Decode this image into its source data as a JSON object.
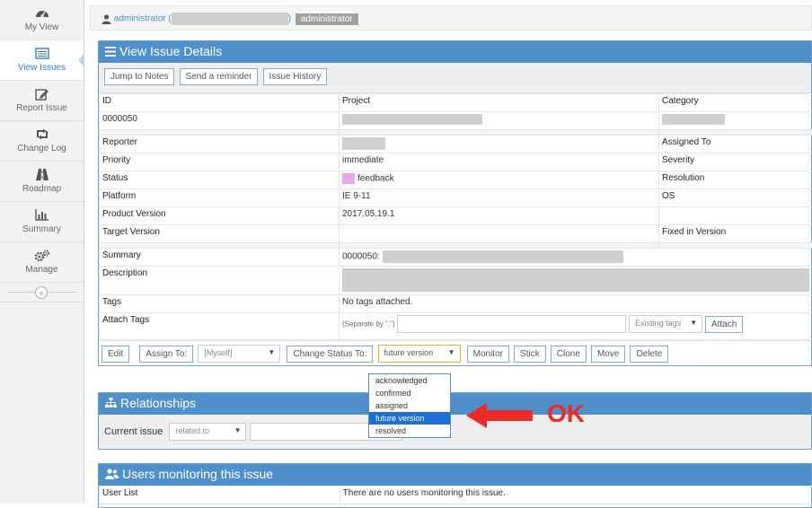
{
  "sidebar": {
    "items": [
      {
        "label": "My View",
        "icon": "dashboard-icon"
      },
      {
        "label": "View Issues",
        "icon": "list-icon",
        "active": true
      },
      {
        "label": "Report Issue",
        "icon": "edit-icon"
      },
      {
        "label": "Change Log",
        "icon": "retweet-icon"
      },
      {
        "label": "Roadmap",
        "icon": "road-icon"
      },
      {
        "label": "Summary",
        "icon": "bar-chart-icon"
      },
      {
        "label": "Manage",
        "icon": "gears-icon"
      }
    ],
    "collapse_glyph": "«"
  },
  "breadcrumb": {
    "user": "administrator (",
    "user_suffix": ")",
    "role": "administrator"
  },
  "issue": {
    "title": "View Issue Details",
    "toolbar": [
      "Jump to Notes",
      "Send a reminder",
      "Issue History"
    ],
    "headers": {
      "id": "ID",
      "project": "Project",
      "category": "Category"
    },
    "id": "0000050",
    "fields": {
      "reporter": "Reporter",
      "assigned_to": "Assigned To",
      "priority": "Priority",
      "priority_value": "immediate",
      "severity": "Severity",
      "status": "Status",
      "status_value": "feedback",
      "status_color": "#e8a8ea",
      "resolution": "Resolution",
      "platform": "Platform",
      "platform_value": "IE 9-11",
      "os": "OS",
      "product_version": "Product Version",
      "product_version_value": "2017.05.19.1",
      "target_version": "Target Version",
      "fixed_in_version": "Fixed in Version",
      "summary": "Summary",
      "summary_value": "0000050:",
      "description": "Description",
      "tags": "Tags",
      "tags_value": "No tags attached.",
      "attach_tags": "Attach Tags",
      "separate_by": "(Separate by \",\")",
      "existing_tags": "Existing tags",
      "attach": "Attach"
    },
    "actions": {
      "edit": "Edit",
      "assign_to": "Assign To:",
      "myself": "[Myself]",
      "change_status_to": "Change Status To:",
      "status_selected": "future version",
      "monitor": "Monitor",
      "stick": "Stick",
      "clone": "Clone",
      "move": "Move",
      "delete": "Delete"
    },
    "status_options": [
      "acknowledged",
      "confirmed",
      "assigned",
      "future version",
      "resolved"
    ],
    "status_selected_index": 3
  },
  "relationships": {
    "title": "Relationships",
    "current_issue": "Current issue",
    "relation": "related to"
  },
  "monitoring": {
    "title": "Users monitoring this issue",
    "user_list": "User List",
    "empty": "There are no users monitoring this issue."
  },
  "annotation": {
    "text": "OK",
    "color": "#ee2a27"
  },
  "colors": {
    "accent": "#4f8fca",
    "link": "#4c8fbd"
  }
}
